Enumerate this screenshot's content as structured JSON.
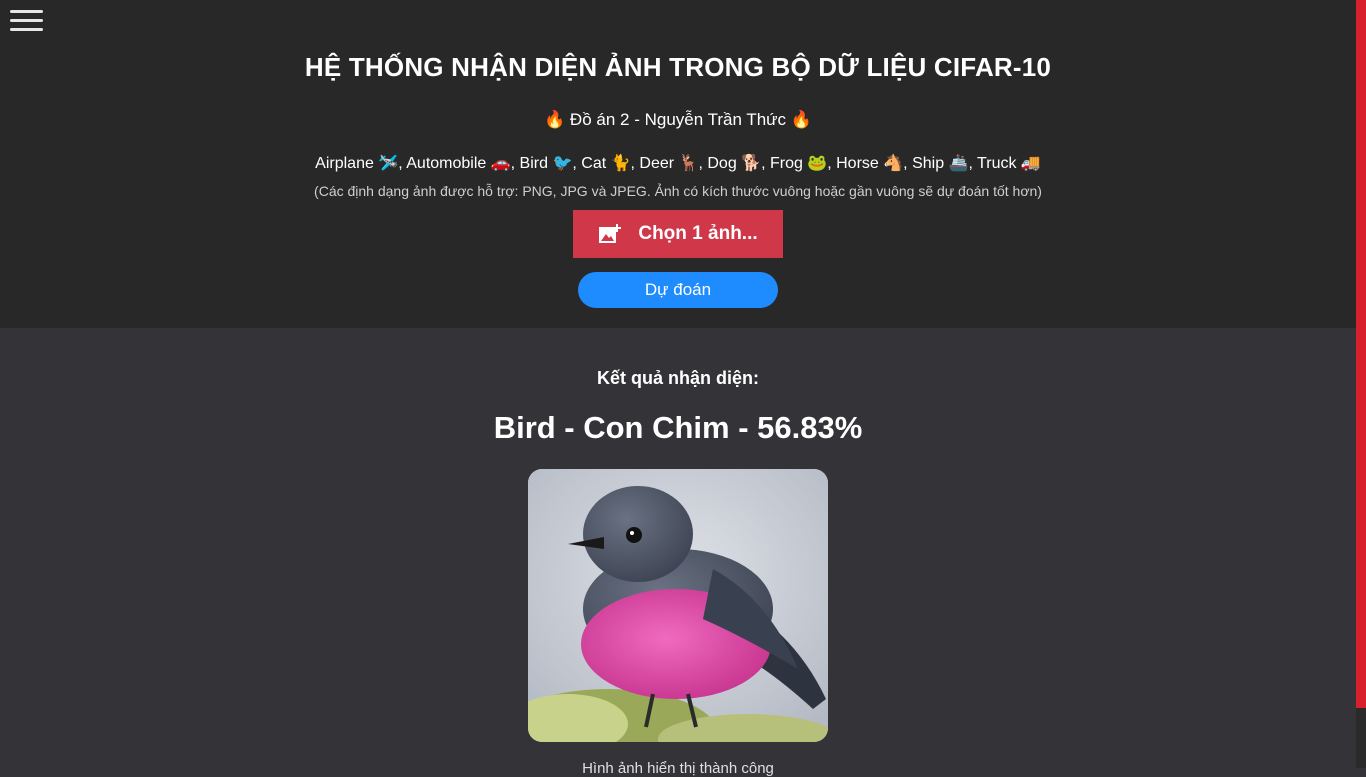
{
  "header": {
    "title": "HỆ THỐNG NHẬN DIỆN ẢNH TRONG BỘ DỮ LIỆU CIFAR-10",
    "subtitle": "🔥 Đồ án 2 - Nguyễn Trần Thức 🔥",
    "classes_line": "Airplane 🛩️, Automobile 🚗, Bird 🐦, Cat 🐈, Deer 🦌, Dog 🐕, Frog 🐸, Horse 🐴, Ship 🚢, Truck 🚚",
    "hint": "(Các định dạng ảnh được hỗ trợ: PNG, JPG và JPEG. Ảnh có kích thước vuông hoặc gần vuông sẽ dự đoán tốt hơn)"
  },
  "buttons": {
    "choose_label": "Chọn 1 ảnh...",
    "predict_label": "Dự đoán"
  },
  "result": {
    "label": "Kết quả nhận diện:",
    "value": "Bird - Con Chim - 56.83%",
    "caption": "Hình ảnh hiển thị thành công"
  },
  "colors": {
    "choose_button": "#d0384a",
    "predict_button": "#1e8cff",
    "scrollbar_accent": "#d8202c"
  },
  "icons": {
    "menu": "hamburger-menu-icon",
    "choose": "add-photo-icon"
  }
}
